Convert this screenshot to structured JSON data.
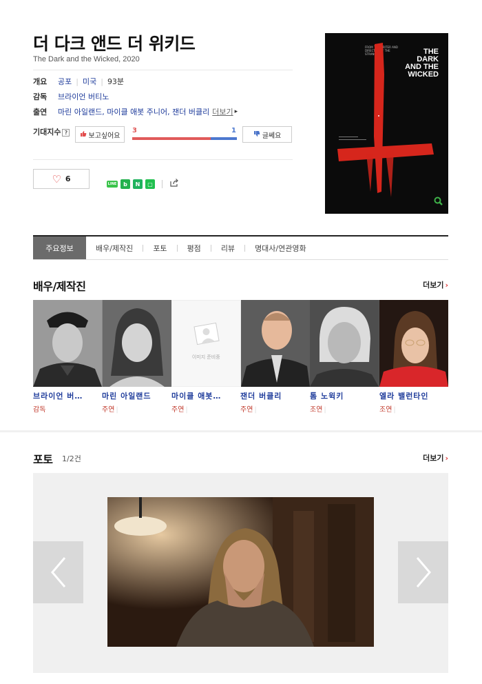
{
  "movie": {
    "title": "더 다크 앤드 더 위키드",
    "subtitle": "The Dark and the Wicked, 2020"
  },
  "info": {
    "overview_label": "개요",
    "genre": "공포",
    "country": "미국",
    "runtime": "93분",
    "director_label": "감독",
    "director": "브라이언 버티노",
    "cast_label": "출연",
    "cast": "마린 아일랜드, 마이클 애봇 주니어, 잰더 버클리",
    "cast_more": "더보기"
  },
  "expectation": {
    "label": "기대지수",
    "help": "?",
    "want_label": "보고싶어요",
    "meh_label": "글쎄요",
    "want_count": "3",
    "meh_count": "1",
    "want_fraction": 0.75
  },
  "like": {
    "count": "6"
  },
  "share": {
    "icons": [
      "line-icon",
      "band-icon",
      "bookmark-icon",
      "memo-icon",
      "share-icon"
    ],
    "line_text": "LINE",
    "band_text": "b",
    "bookmark_text": "N",
    "memo_text": "▢"
  },
  "poster": {
    "title_line1": "THE",
    "title_line2": "DARK",
    "title_line3": "AND THE",
    "title_line4": "WICKED",
    "tagline": "FROM THE WRITER AND DIRECTOR OF THE STRANGERS"
  },
  "tabs": [
    {
      "label": "주요정보"
    },
    {
      "label": "배우/제작진"
    },
    {
      "label": "포토"
    },
    {
      "label": "평점"
    },
    {
      "label": "리뷰"
    },
    {
      "label": "명대사/연관영화"
    }
  ],
  "cast_section": {
    "title": "배우/제작진",
    "more": "더보기",
    "placeholder_text": "이미지 준비중",
    "members": [
      {
        "name": "브라이언 버…",
        "role": "감독"
      },
      {
        "name": "마린 아일랜드",
        "role": "주연"
      },
      {
        "name": "마이클 애봇…",
        "role": "주연"
      },
      {
        "name": "잰더 버클리",
        "role": "주연"
      },
      {
        "name": "톰 노윅키",
        "role": "조연"
      },
      {
        "name": "엘라 밸런타인",
        "role": "조연"
      }
    ]
  },
  "photo_section": {
    "title": "포토",
    "count": "1/2건",
    "more": "더보기"
  },
  "colors": {
    "link": "#1f3c9b",
    "accent_red": "#e05a5a",
    "accent_blue": "#4c78cf",
    "role_red": "#c0392b",
    "tab_active": "#6b6b6b"
  }
}
